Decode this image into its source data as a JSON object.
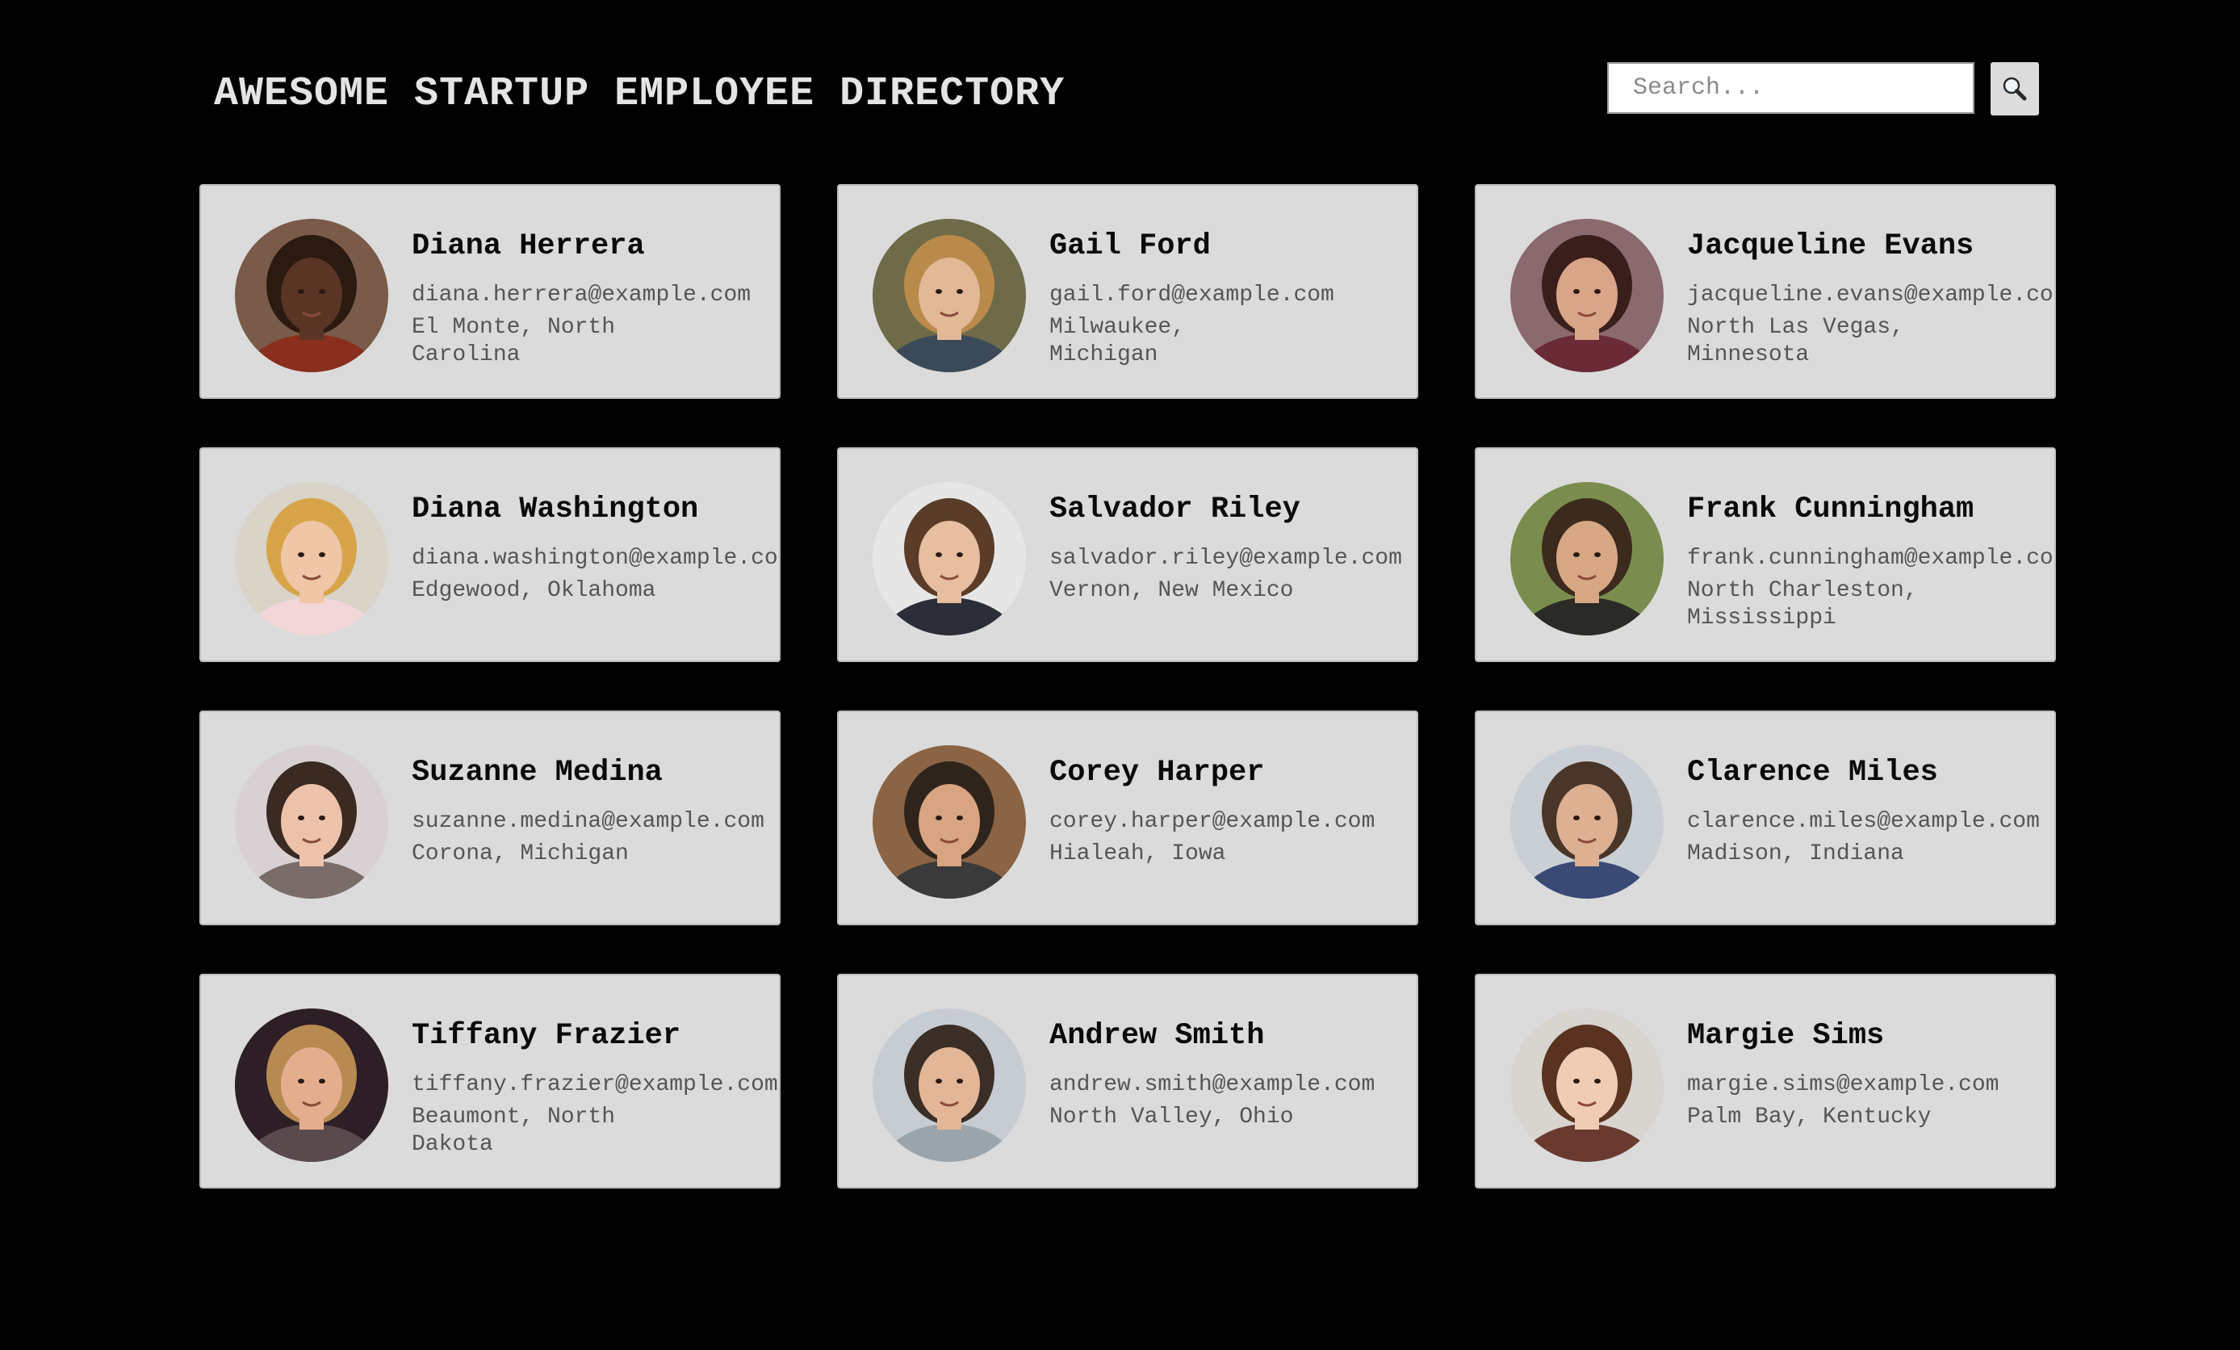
{
  "header": {
    "title": "AWESOME STARTUP EMPLOYEE DIRECTORY",
    "search_placeholder": "Search...",
    "search_icon": "magnifier-icon"
  },
  "employees": [
    {
      "name": "Diana Herrera",
      "email": "diana.herrera@example.com",
      "location": "El Monte, North Carolina",
      "skin": "#5a3524",
      "hair": "#2a1a12",
      "bg": "#7a5a48",
      "shirt": "#8a2e1e"
    },
    {
      "name": "Gail Ford",
      "email": "gail.ford@example.com",
      "location": "Milwaukee, Michigan",
      "skin": "#e2b896",
      "hair": "#b98a4a",
      "bg": "#6f6a48",
      "shirt": "#3a4a58"
    },
    {
      "name": "Jacqueline Evans",
      "email": "jacqueline.evans@example.com",
      "location": "North Las Vegas, Minnesota",
      "skin": "#d9a588",
      "hair": "#3a1e1c",
      "bg": "#8a6a6e",
      "shirt": "#6a2a36"
    },
    {
      "name": "Diana Washington",
      "email": "diana.washington@example.com",
      "location": "Edgewood, Oklahoma",
      "skin": "#efc6a6",
      "hair": "#d8a44a",
      "bg": "#dad3c8",
      "shirt": "#f2d6d8"
    },
    {
      "name": "Salvador Riley",
      "email": "salvador.riley@example.com",
      "location": "Vernon, New Mexico",
      "skin": "#e8bea0",
      "hair": "#5a3c28",
      "bg": "#e6e6e6",
      "shirt": "#2b2d38"
    },
    {
      "name": "Frank Cunningham",
      "email": "frank.cunningham@example.com",
      "location": "North Charleston, Mississippi",
      "skin": "#d7a784",
      "hair": "#3c2a1e",
      "bg": "#7b8d4e",
      "shirt": "#2a2a26"
    },
    {
      "name": "Suzanne Medina",
      "email": "suzanne.medina@example.com",
      "location": "Corona, Michigan",
      "skin": "#ecc3aa",
      "hair": "#3a2a22",
      "bg": "#d9d0d3",
      "shirt": "#7a6c68"
    },
    {
      "name": "Corey Harper",
      "email": "corey.harper@example.com",
      "location": "Hialeah, Iowa",
      "skin": "#d8a482",
      "hair": "#2e241c",
      "bg": "#8a6444",
      "shirt": "#3a3a3a"
    },
    {
      "name": "Clarence Miles",
      "email": "clarence.miles@example.com",
      "location": "Madison, Indiana",
      "skin": "#ddb092",
      "hair": "#4a3628",
      "bg": "#c9cfd4",
      "shirt": "#3a4a74"
    },
    {
      "name": "Tiffany Frazier",
      "email": "tiffany.frazier@example.com",
      "location": "Beaumont, North Dakota",
      "skin": "#e4ae8e",
      "hair": "#b78a52",
      "bg": "#2e1e26",
      "shirt": "#5a4a4e"
    },
    {
      "name": "Andrew Smith",
      "email": "andrew.smith@example.com",
      "location": "North Valley, Ohio",
      "skin": "#e2b696",
      "hair": "#3a2e26",
      "bg": "#c6ccd2",
      "shirt": "#9aa4ac"
    },
    {
      "name": "Margie Sims",
      "email": "margie.sims@example.com",
      "location": "Palm Bay, Kentucky",
      "skin": "#f0ccb4",
      "hair": "#5a3220",
      "bg": "#d8d4d0",
      "shirt": "#6a3a30"
    }
  ]
}
